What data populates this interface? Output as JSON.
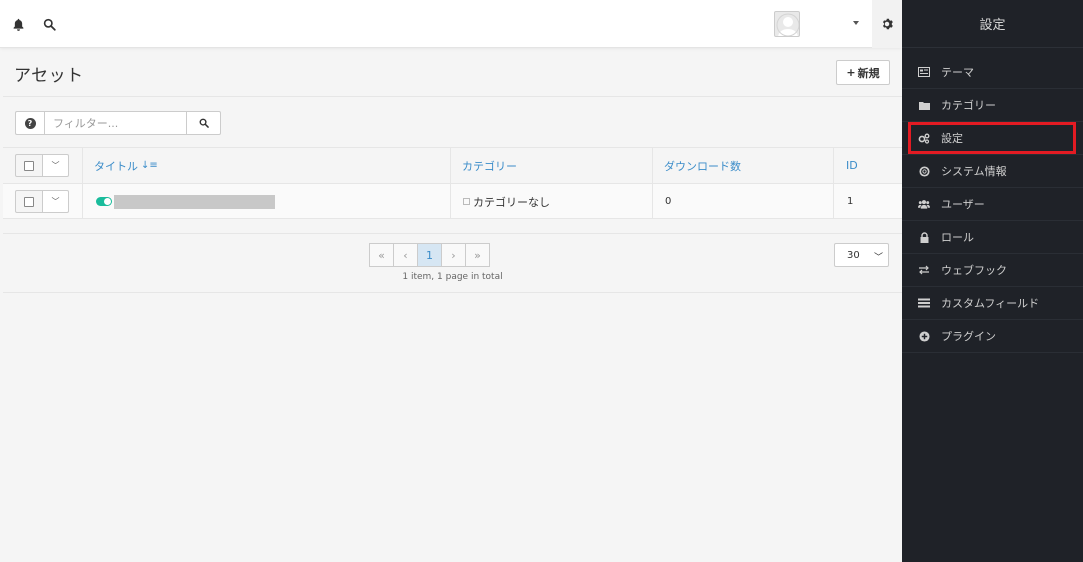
{
  "header": {
    "title": "アセット",
    "new_button": "新規",
    "new_prefix": "+"
  },
  "filter": {
    "placeholder": "フィルター..."
  },
  "table": {
    "columns": [
      "タイトル",
      "カテゴリー",
      "ダウンロード数",
      "ID"
    ],
    "sort_indicator": "↓",
    "rows": [
      {
        "category": "カテゴリーなし",
        "downloads": "0",
        "id": "1",
        "published": true
      }
    ]
  },
  "pagination": {
    "first": "«",
    "prev": "‹",
    "current": "1",
    "next": "›",
    "last": "»",
    "info": "1 item, 1 page in total",
    "per_page": "30"
  },
  "sidebar": {
    "title": "設定",
    "items": [
      {
        "label": "テーマ",
        "icon": "theme-icon"
      },
      {
        "label": "カテゴリー",
        "icon": "folder-icon"
      },
      {
        "label": "設定",
        "icon": "cogs-icon",
        "highlighted": true
      },
      {
        "label": "システム情報",
        "icon": "life-ring-icon"
      },
      {
        "label": "ユーザー",
        "icon": "users-icon"
      },
      {
        "label": "ロール",
        "icon": "lock-icon"
      },
      {
        "label": "ウェブフック",
        "icon": "exchange-icon"
      },
      {
        "label": "カスタムフィールド",
        "icon": "list-icon"
      },
      {
        "label": "プラグイン",
        "icon": "plus-circle-icon"
      }
    ]
  },
  "colors": {
    "sidebar_bg": "#1f2228",
    "link": "#3a8cc9",
    "toggle_on": "#1abc9c",
    "highlight": "#e31b23"
  }
}
